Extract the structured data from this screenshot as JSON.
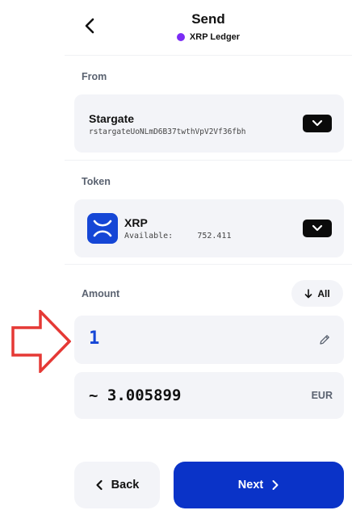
{
  "header": {
    "title": "Send",
    "network_name": "XRP Ledger",
    "network_color": "#7b2cf5"
  },
  "from": {
    "label": "From",
    "account_name": "Stargate",
    "account_address": "rstargateUoNLmD6B37twthVpV2Vf36fbh"
  },
  "token": {
    "label": "Token",
    "symbol": "XRP",
    "available_label": "Available:",
    "available_value": "752.411",
    "logo_color": "#1546d6"
  },
  "amount": {
    "label": "Amount",
    "all_label": "All",
    "value": "1",
    "fiat_value": "~ 3.005899",
    "fiat_currency": "EUR"
  },
  "footer": {
    "back_label": "Back",
    "next_label": "Next",
    "next_color": "#0a33c8"
  },
  "annotation": {
    "arrow_color": "#e53935"
  }
}
